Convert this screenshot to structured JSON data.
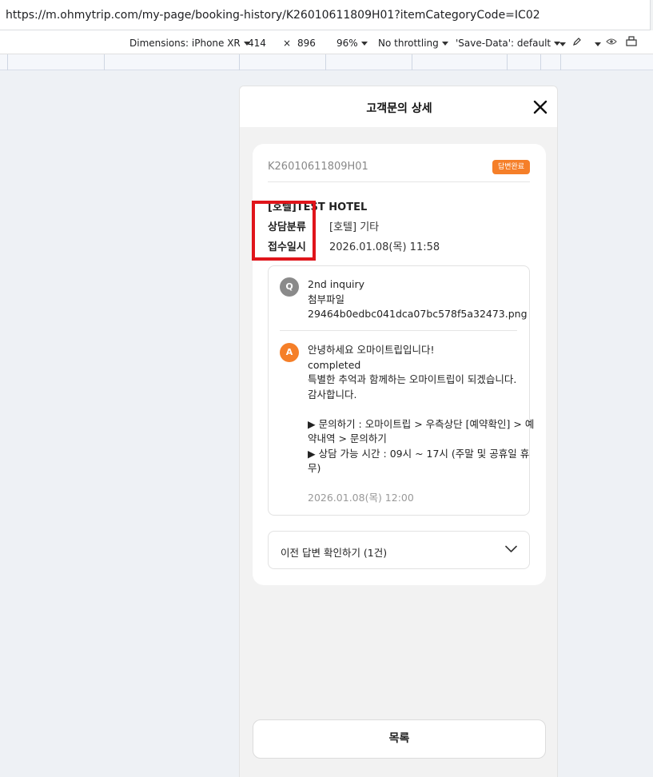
{
  "browser": {
    "url": "https://m.ohmytrip.com/my-page/booking-history/K26010611809H01?itemCategoryCode=IC02"
  },
  "devtools": {
    "dimensions_label": "Dimensions: iPhone XR",
    "width": "414",
    "times": "×",
    "height": "896",
    "zoom": "96%",
    "throttling": "No throttling",
    "save_data": "'Save-Data': default",
    "icons": [
      "dropdown-icon",
      "pen-icon",
      "eye-icon",
      "rotate-icon"
    ]
  },
  "modal": {
    "title": "고객문의 상세",
    "close_icon": "close-icon"
  },
  "inquiry": {
    "booking_no": "K26010611809H01",
    "status": "답변완료",
    "product_name": "[호텔]TEST HOTEL",
    "category_label": "상담분류",
    "category_value": "[호텔] 기타",
    "date_label": "접수일시",
    "date_value": "2026.01.08(목) 11:58"
  },
  "question": {
    "marker": "Q",
    "lines": [
      "2nd inquiry",
      "첨부파일",
      "29464b0edbc041dca07bc578f5a32473.png"
    ]
  },
  "answer": {
    "marker": "A",
    "lines": [
      "안녕하세요 오마이트립입니다!",
      "completed",
      "특별한 추억과 함께하는 오마이트립이 되겠습니다.",
      "감사합니다.",
      "",
      "▶ 문의하기 : 오마이트립 > 우측상단 [예약확인] > 예",
      "약내역 > 문의하기",
      "▶ 상담 가능 시간 : 09시 ~ 17시 (주말 및 공휴일 휴",
      "무)"
    ],
    "date": "2026.01.08(목) 12:00"
  },
  "previous_answers": {
    "label": "이전 답변 확인하기 (1건)"
  },
  "footer": {
    "list_button": "목록"
  },
  "colors": {
    "accent": "#f57f29",
    "annotation": "#e0151b"
  }
}
